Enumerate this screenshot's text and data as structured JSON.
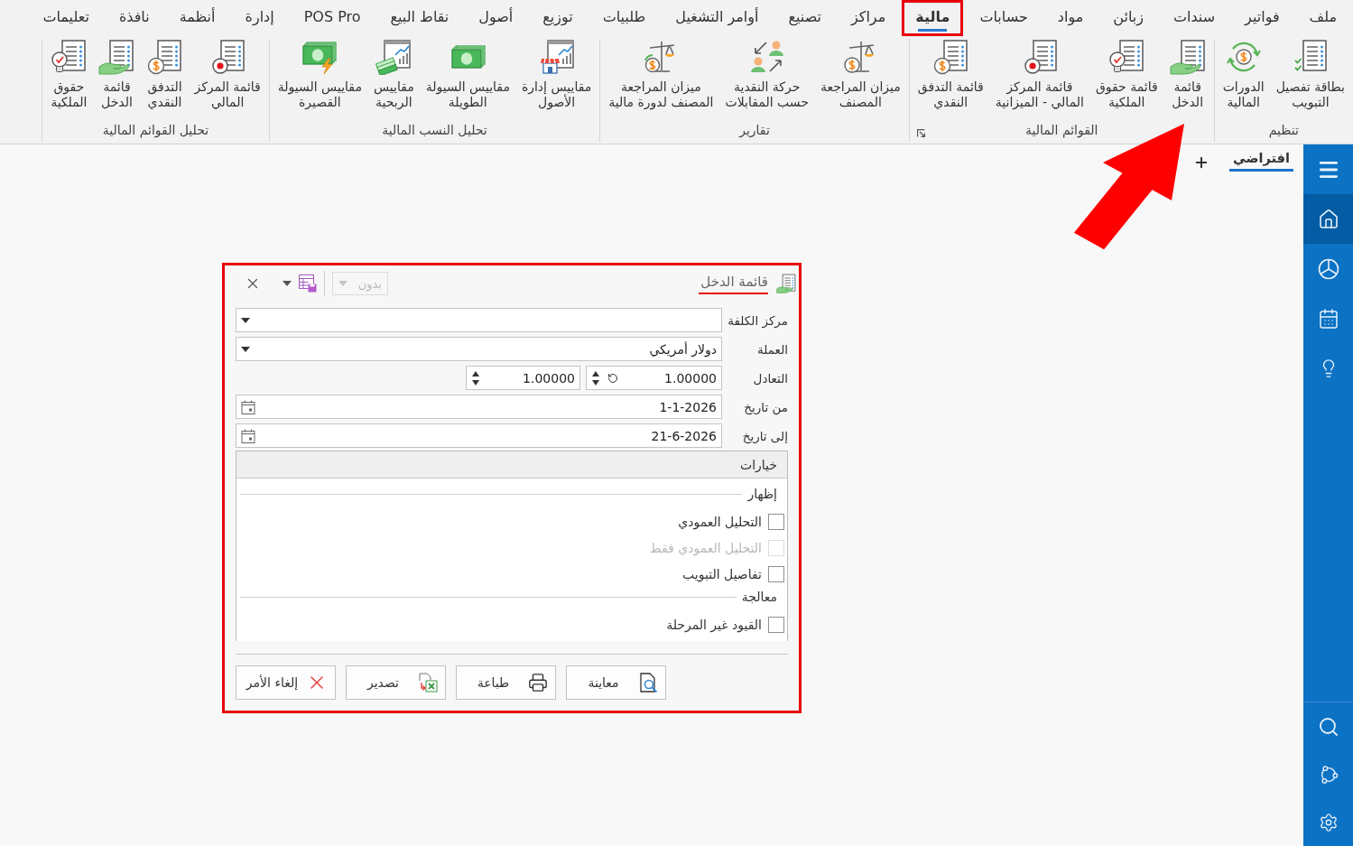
{
  "ribbon": {
    "tabs": [
      {
        "label": "ملف",
        "selected": false,
        "highlighted": false
      },
      {
        "label": "فواتير",
        "selected": false,
        "highlighted": false
      },
      {
        "label": "سندات",
        "selected": false,
        "highlighted": false
      },
      {
        "label": "زبائن",
        "selected": false,
        "highlighted": false
      },
      {
        "label": "مواد",
        "selected": false,
        "highlighted": false
      },
      {
        "label": "حسابات",
        "selected": false,
        "highlighted": false
      },
      {
        "label": "مالية",
        "selected": true,
        "highlighted": true
      },
      {
        "label": "مراكز",
        "selected": false,
        "highlighted": false
      },
      {
        "label": "تصنيع",
        "selected": false,
        "highlighted": false
      },
      {
        "label": "أوامر التشغيل",
        "selected": false,
        "highlighted": false
      },
      {
        "label": "طلبيات",
        "selected": false,
        "highlighted": false
      },
      {
        "label": "توزيع",
        "selected": false,
        "highlighted": false
      },
      {
        "label": "أصول",
        "selected": false,
        "highlighted": false
      },
      {
        "label": "نقاط البيع",
        "selected": false,
        "highlighted": false
      },
      {
        "label": "POS Pro",
        "selected": false,
        "highlighted": false
      },
      {
        "label": "إدارة",
        "selected": false,
        "highlighted": false
      },
      {
        "label": "أنظمة",
        "selected": false,
        "highlighted": false
      },
      {
        "label": "نافذة",
        "selected": false,
        "highlighted": false
      },
      {
        "label": "تعليمات",
        "selected": false,
        "highlighted": false
      }
    ],
    "groups": [
      {
        "title": "تنظيم",
        "launcher": false,
        "items": [
          {
            "label": "بطاقة تفصيل\nالتبويب",
            "kind": "checklist"
          },
          {
            "label": "الدورات\nالمالية",
            "kind": "cycle"
          }
        ]
      },
      {
        "title": "القوائم المالية",
        "launcher": true,
        "items": [
          {
            "label": "قائمة\nالدخل",
            "kind": "hand"
          },
          {
            "label": "قائمة حقوق\nالملكية",
            "kind": "bulb"
          },
          {
            "label": "قائمة المركز\nالمالي - الميزانية",
            "kind": "dot"
          },
          {
            "label": "قائمة التدفق\nالنقدي",
            "kind": "coin"
          }
        ]
      },
      {
        "title": "تقارير",
        "launcher": false,
        "items": [
          {
            "label": "ميزان المراجعة\nالمصنف",
            "kind": "scale"
          },
          {
            "label": "حركة النقدية\nحسب المقابلات",
            "kind": "people"
          },
          {
            "label": "ميزان المراجعة\nالمصنف لدورة مالية",
            "kind": "scalecycle"
          }
        ]
      },
      {
        "title": "تحليل النسب المالية",
        "launcher": false,
        "items": [
          {
            "label": "مقاييس إدارة\nالأصول",
            "kind": "shop"
          },
          {
            "label": "مقاييس السيولة\nالطويلة",
            "kind": "money"
          },
          {
            "label": "مقاييس\nالربحية",
            "kind": "coins"
          },
          {
            "label": "مقاييس السيولة\nالقصيرة",
            "kind": "bolt"
          }
        ]
      },
      {
        "title": "تحليل القوائم المالية",
        "launcher": false,
        "items": [
          {
            "label": "قائمة المركز\nالمالي",
            "kind": "dot"
          },
          {
            "label": "التدفق\nالنقدي",
            "kind": "coin"
          },
          {
            "label": "قائمة\nالدخل",
            "kind": "hand"
          },
          {
            "label": "حقوق\nالملكية",
            "kind": "bulb"
          }
        ]
      }
    ]
  },
  "sidebar": {
    "top_items": [
      {
        "kind": "menu",
        "selected": false
      },
      {
        "kind": "home",
        "selected": true
      },
      {
        "kind": "wheel",
        "selected": false
      },
      {
        "kind": "calendar",
        "selected": false
      },
      {
        "kind": "bulb",
        "selected": false
      }
    ],
    "bottom_items": [
      {
        "kind": "search",
        "selected": false
      },
      {
        "kind": "nodes",
        "selected": false
      },
      {
        "kind": "gear",
        "selected": false
      }
    ]
  },
  "workspace": {
    "tabs": [
      {
        "label": "افتراضي",
        "selected": true
      }
    ]
  },
  "dialog": {
    "highlighted": true,
    "title": "قائمة الدخل",
    "layout_combo": {
      "value": "بدون",
      "disabled": true
    },
    "fields": [
      {
        "kind": "combo",
        "label": "مركز الكلفة"
      },
      {
        "kind": "combo",
        "label": "العملة",
        "value": "دولار أمريكي"
      },
      {
        "kind": "spin_pair",
        "label": "التعادل",
        "values": [
          "1.00000",
          "1.00000"
        ]
      },
      {
        "kind": "date",
        "label": "من تاريخ",
        "value": "1-1-2026"
      },
      {
        "kind": "date",
        "label": "إلى تاريخ",
        "value": "21-6-2026"
      }
    ],
    "options": {
      "title": "خيارات",
      "sections": [
        {
          "title": "إظهار",
          "items": [
            {
              "label": "التحليل العمودي",
              "checked": false,
              "disabled": false
            },
            {
              "label": "التحليل العمودي فقط",
              "checked": false,
              "disabled": true
            },
            {
              "label": "تفاصيل التبويب",
              "checked": false,
              "disabled": false
            }
          ]
        },
        {
          "title": "معالجة",
          "items": [
            {
              "label": "القيود غير المرحلة",
              "checked": false,
              "disabled": false
            }
          ]
        }
      ]
    },
    "buttons": [
      {
        "label": "معاينة",
        "kind": "preview"
      },
      {
        "label": "طباعة",
        "kind": "print"
      },
      {
        "label": "تصدير",
        "kind": "export"
      },
      {
        "label": "إلغاء الأمر",
        "kind": "cancel"
      }
    ]
  },
  "annotations": [
    {
      "kind": "arrow"
    }
  ]
}
